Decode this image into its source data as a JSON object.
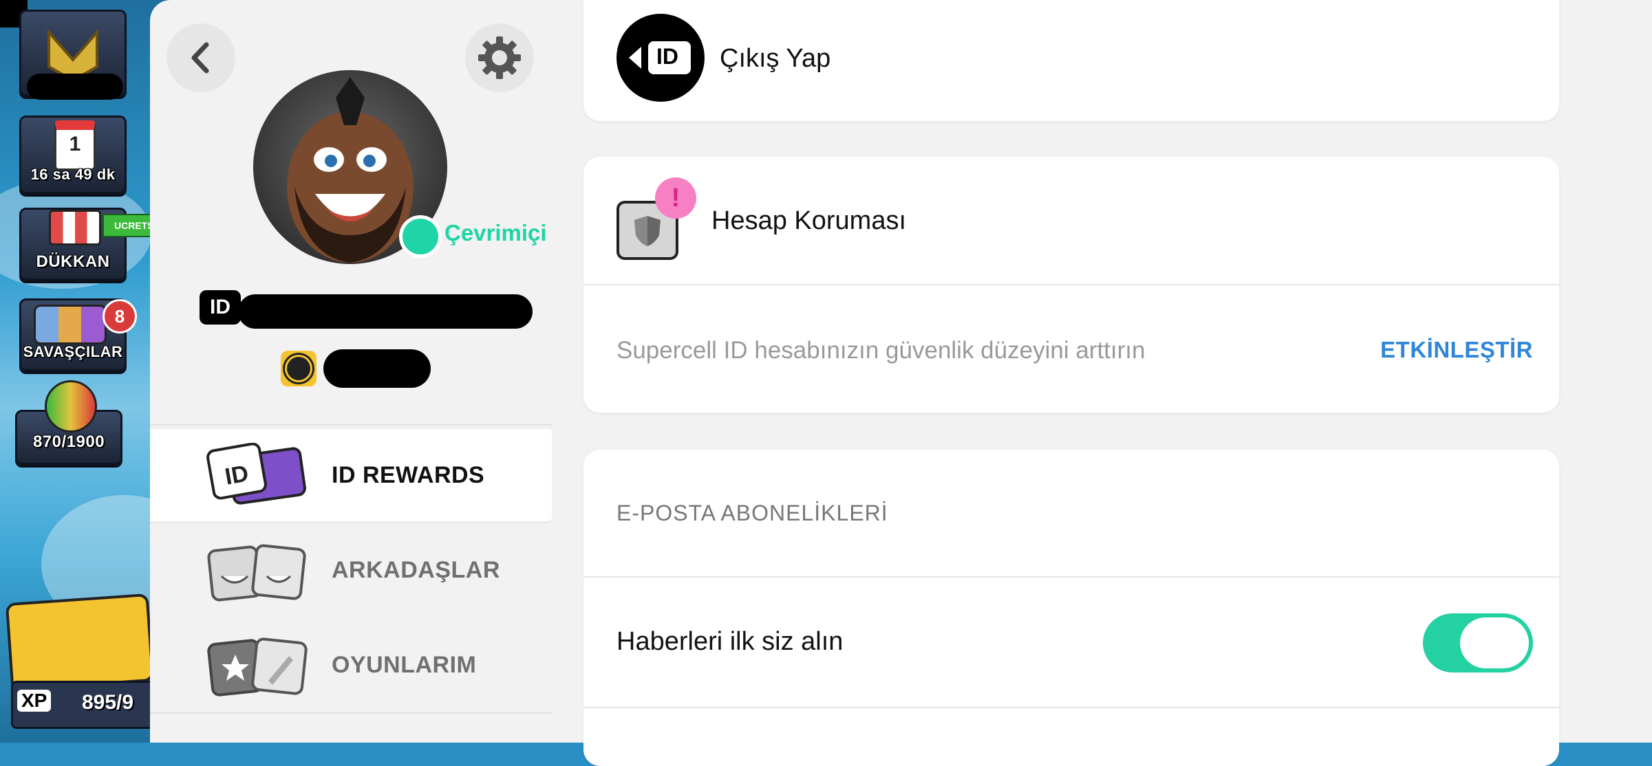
{
  "game_hud": {
    "event_days": "1",
    "event_timer": "16 sa 49 dk",
    "shop_label": "DÜKKAN",
    "shop_badge": "UCRETSIZ",
    "brawlers_label": "SAVAŞÇILAR",
    "brawlers_count": "8",
    "trophy_progress": "870/1900",
    "xp_label": "XP",
    "xp_value": "895/9"
  },
  "profile": {
    "status": "Çevrimiçi",
    "id_badge": "ID"
  },
  "menu": {
    "items": [
      {
        "label": "ID REWARDS",
        "active": true
      },
      {
        "label": "ARKADAŞLAR",
        "active": false
      },
      {
        "label": "OYUNLARIM",
        "active": false
      }
    ]
  },
  "logout": {
    "label": "Çıkış Yap",
    "icon_text": "ID"
  },
  "account_protection": {
    "title": "Hesap Koruması",
    "description": "Supercell ID hesabınızın güvenlik düzeyini arttırın",
    "action": "ETKİNLEŞTİR",
    "alert_mark": "!"
  },
  "email_subscriptions": {
    "header": "E-POSTA ABONELİKLERİ",
    "news_label": "Haberleri ilk siz alın",
    "news_enabled": true
  },
  "colors": {
    "accent_green": "#1fd4a6",
    "link_blue": "#2f86d8",
    "alert_pink": "#f77fc4"
  }
}
